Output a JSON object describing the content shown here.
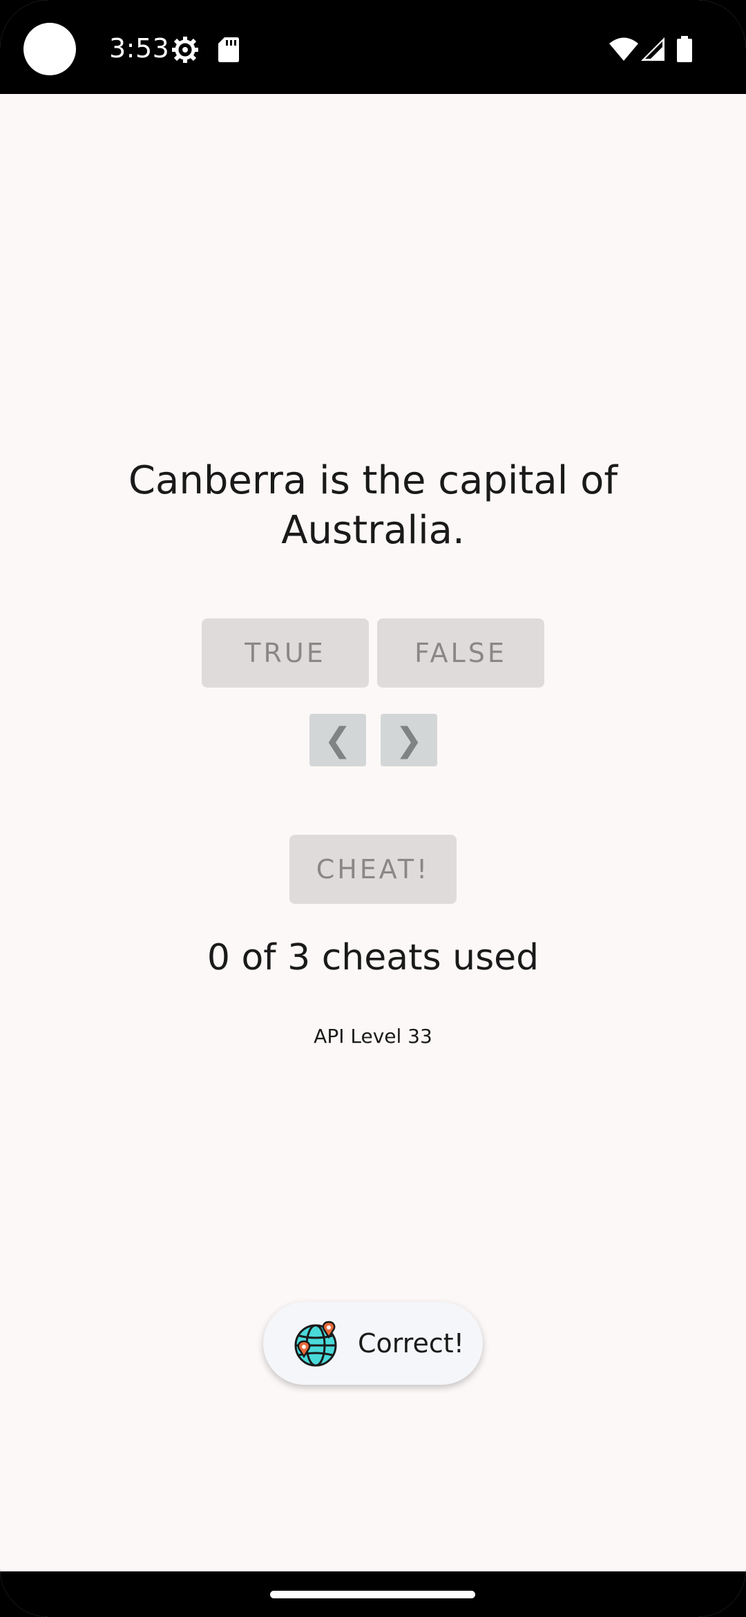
{
  "status_bar": {
    "time": "3:53",
    "icons": [
      "settings-gear-icon",
      "sd-card-icon",
      "wifi-icon",
      "cell-signal-icon",
      "battery-icon"
    ]
  },
  "quiz": {
    "question": "Canberra is the capital of Australia.",
    "true_label": "TRUE",
    "false_label": "FALSE",
    "prev_label": "❮",
    "next_label": "❯",
    "cheat_label": "CHEAT!",
    "cheats_used_text": "0 of 3 cheats used",
    "api_level_text": "API Level 33"
  },
  "toast": {
    "icon": "globe-map-pin-icon",
    "message": "Correct!"
  },
  "colors": {
    "background": "#fcf8f7",
    "button_bg": "#dfdbda",
    "button_text": "#8a8787",
    "nav_button_bg": "#d3d6d6",
    "toast_bg": "#f4f6f9",
    "globe": "#4ad9d9",
    "pin": "#e86a3a"
  }
}
